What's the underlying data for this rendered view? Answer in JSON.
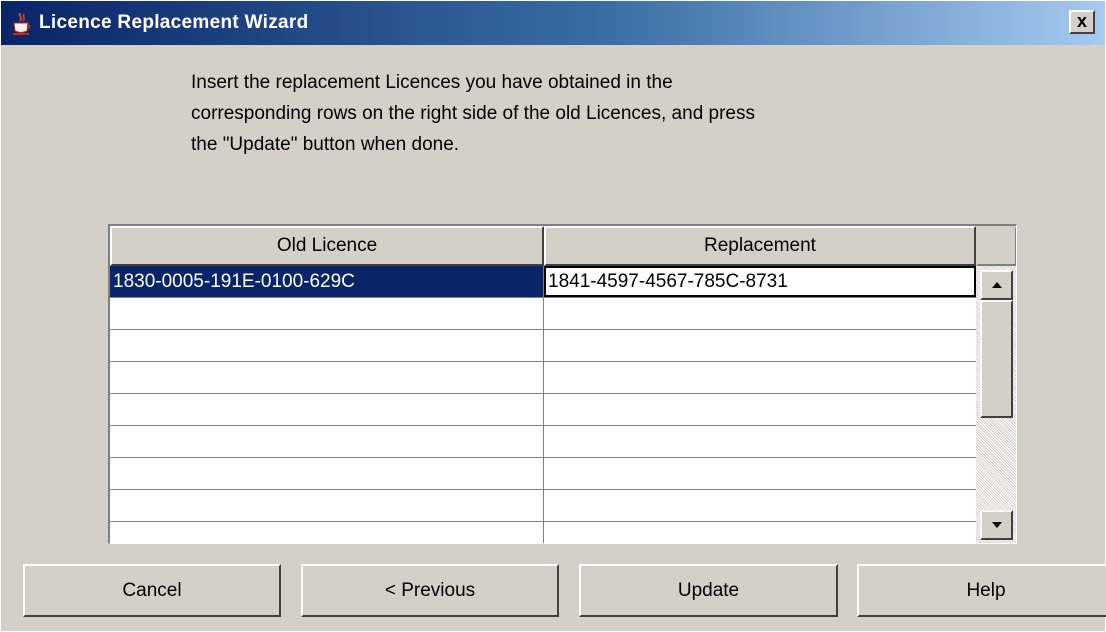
{
  "window": {
    "title": "Licence Replacement Wizard",
    "close_label": "x"
  },
  "instructions": {
    "lines": [
      "Insert the replacement Licences you have obtained in the",
      "corresponding rows on the right side of the old Licences, and press",
      "the \"Update\" button when done."
    ]
  },
  "table": {
    "columns": [
      "Old Licence",
      "Replacement"
    ],
    "rows": [
      {
        "old": "1830-0005-191E-0100-629C",
        "replacement": "1841-4597-4567-785C-8731"
      },
      {
        "old": "",
        "replacement": ""
      },
      {
        "old": "",
        "replacement": ""
      },
      {
        "old": "",
        "replacement": ""
      },
      {
        "old": "",
        "replacement": ""
      },
      {
        "old": "",
        "replacement": ""
      },
      {
        "old": "",
        "replacement": ""
      },
      {
        "old": "",
        "replacement": ""
      }
    ],
    "selected_row": 0
  },
  "buttons": {
    "cancel": "Cancel",
    "previous": "< Previous",
    "update": "Update",
    "help": "Help"
  },
  "colors": {
    "selection": "#0a246a",
    "face": "#d4d0c8",
    "title_gradient_start": "#0a246a",
    "title_gradient_end": "#a6caf0"
  },
  "icons": {
    "title": "java-cup-icon",
    "close": "close-icon",
    "scroll_up": "arrow-up-icon",
    "scroll_down": "arrow-down-icon"
  }
}
